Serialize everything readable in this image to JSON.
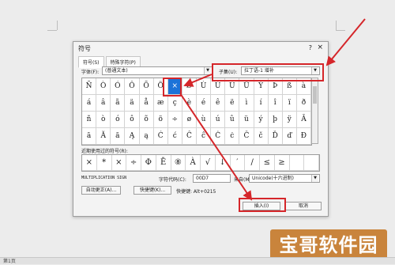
{
  "dialog": {
    "title": "符号",
    "help": "?",
    "close": "×",
    "tabs": [
      "符号(S)",
      "特殊字符(P)"
    ],
    "font_label": "字体(F):",
    "font_value": "(普通文本)",
    "subset_label": "子集(U):",
    "subset_value": "拉丁语-1 增补",
    "symbols": [
      "Ñ",
      "Ò",
      "Ó",
      "Ô",
      "Õ",
      "Ö",
      "×",
      "Ø",
      "Ù",
      "Ú",
      "Û",
      "Ü",
      "Ý",
      "Þ",
      "ß",
      "à",
      "á",
      "â",
      "ã",
      "ä",
      "å",
      "æ",
      "ç",
      "è",
      "é",
      "ê",
      "ë",
      "ì",
      "í",
      "î",
      "ï",
      "ð",
      "ñ",
      "ò",
      "ó",
      "ô",
      "õ",
      "ö",
      "÷",
      "ø",
      "ù",
      "ú",
      "û",
      "ü",
      "ý",
      "þ",
      "ÿ",
      "Ā",
      "ā",
      "Ă",
      "ă",
      "Ą",
      "ą",
      "Ć",
      "ć",
      "Ĉ",
      "ĉ",
      "Ċ",
      "ċ",
      "Č",
      "č",
      "Ď",
      "ď",
      "Đ"
    ],
    "selected_index": 6,
    "recent_label": "近期使用过的符号(R):",
    "recent_symbols": [
      "×",
      "*",
      "×",
      "÷",
      "Φ",
      "Ē",
      "⑧",
      "À",
      "√",
      "↓",
      "′",
      "/",
      "≤",
      "≥",
      "",
      ""
    ],
    "char_name": "MULTIPLICATION SIGN",
    "char_code_label": "字符代码(C):",
    "char_code_value": "00D7",
    "from_label": "来自(M):",
    "from_value": "Unicode(十六进制)",
    "autocorrect_button": "自动更正(A)...",
    "shortcut_button": "快捷键(K)...",
    "shortcut_text": "快捷键: Alt+0215",
    "insert_button": "插入(I)",
    "cancel_button": "取消"
  },
  "watermark": "宝哥软件园",
  "status_text": "第1页",
  "colors": {
    "highlight": "#d5262a",
    "selection": "#1c73d8",
    "watermark_bg": "#c77c2e"
  }
}
